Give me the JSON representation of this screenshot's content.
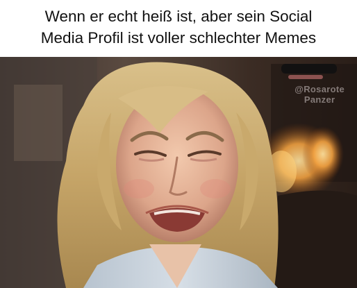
{
  "caption": {
    "line1": "Wenn er echt heiß ist, aber sein Social",
    "line2": "Media Profil ist voller schlechter Memes"
  },
  "watermark": {
    "line1": "@Rosarote",
    "line2": "Panzer"
  },
  "photo": {
    "subject": "crying-woman-photo"
  }
}
